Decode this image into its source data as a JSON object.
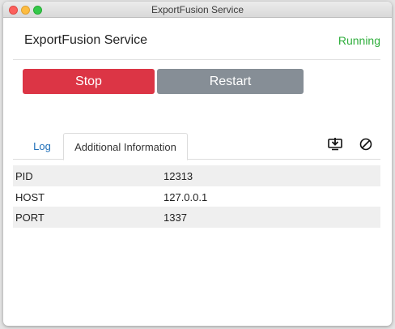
{
  "window": {
    "title": "ExportFusion Service"
  },
  "header": {
    "service_name": "ExportFusion Service",
    "status": "Running",
    "status_color": "#2fae3c"
  },
  "actions": {
    "stop_label": "Stop",
    "restart_label": "Restart",
    "stop_color": "#dc3545",
    "restart_color": "#868e96"
  },
  "tabs": [
    {
      "label": "Log",
      "active": false
    },
    {
      "label": "Additional Information",
      "active": true
    }
  ],
  "toolbar": {
    "icons": [
      "download-icon",
      "clear-icon"
    ]
  },
  "info": [
    {
      "key": "PID",
      "value": "12313"
    },
    {
      "key": "HOST",
      "value": "127.0.0.1"
    },
    {
      "key": "PORT",
      "value": "1337"
    }
  ]
}
